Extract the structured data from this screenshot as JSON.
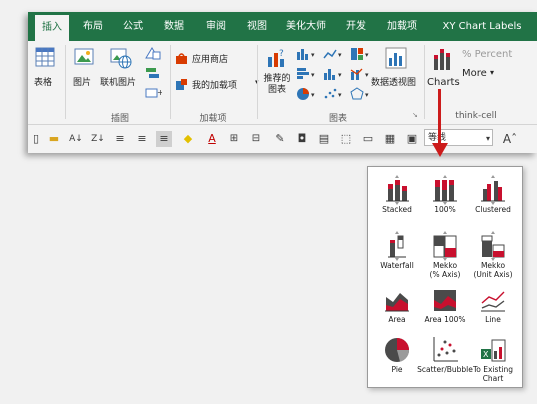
{
  "tabs": [
    "插入",
    "布局",
    "公式",
    "数据",
    "审阅",
    "视图",
    "美化大师",
    "开发",
    "加载项",
    "XY Chart Labels"
  ],
  "ribbon": {
    "table_label": "表格",
    "picture_label": "图片",
    "online_picture_label": "联机图片",
    "illustrations_group": "插图",
    "store_label": "应用商店",
    "my_addins_label": "我的加载项",
    "addins_group": "加载项",
    "recommended_charts_label": "推荐的\n图表",
    "charts_group": "图表",
    "pivot_chart_label": "数据透视图",
    "charts_button_label": "Charts",
    "percent_label": "% Percent",
    "more_label": "More",
    "thinkcell_group": "think-cell"
  },
  "qat": {
    "font_name": "等线"
  },
  "dropdown": {
    "items": [
      {
        "label": "Stacked"
      },
      {
        "label": "100%"
      },
      {
        "label": "Clustered"
      },
      {
        "label": "Waterfall"
      },
      {
        "label": "Mekko\n(% Axis)"
      },
      {
        "label": "Mekko\n(Unit Axis)"
      },
      {
        "label": "Area"
      },
      {
        "label": "Area 100%"
      },
      {
        "label": "Line"
      },
      {
        "label": "Pie"
      },
      {
        "label": "Scatter/Bubble"
      },
      {
        "label": "To Existing\nChart"
      }
    ]
  },
  "colors": {
    "excel_green": "#217346",
    "arrow_red": "#cc1b1b",
    "chart_red": "#c8102e",
    "chart_dark": "#4a4a4a"
  }
}
